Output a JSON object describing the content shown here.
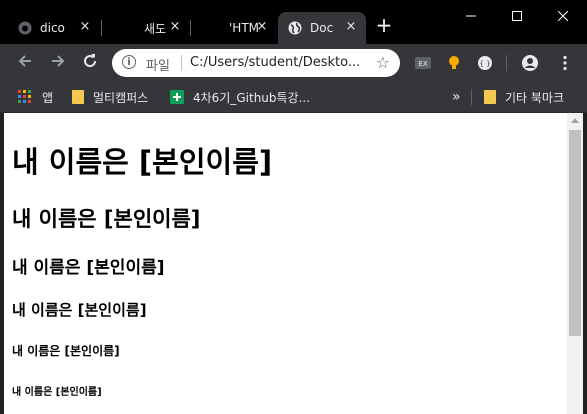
{
  "browser": {
    "tabs": [
      {
        "title": "dico",
        "icon": "github-icon"
      },
      {
        "title": "새도",
        "icon": "blank-icon"
      },
      {
        "title": "'HTM",
        "icon": "blank-icon"
      },
      {
        "title": "Doc",
        "icon": "globe-icon",
        "active": true
      }
    ],
    "close_glyph": "×",
    "new_tab_glyph": "+",
    "address": {
      "scheme_label": "파일",
      "url": "C:/Users/student/Deskto..."
    },
    "bookmarks": {
      "apps_label": "앱",
      "items": [
        {
          "label": "멀티캠퍼스",
          "icon": "folder-icon"
        },
        {
          "label": "4차6기_Github특강...",
          "icon": "sheets-icon"
        }
      ],
      "overflow": "»",
      "other_label": "기타 북마크"
    },
    "colors": {
      "tabbar": "#000000",
      "toolbar": "#35363a",
      "text": "#e8eaed",
      "folder": "#f5c94d"
    }
  },
  "page": {
    "headings": [
      "내 이름은 [본인이름]",
      "내 이름은 [본인이름]",
      "내 이름은 [본인이름]",
      "내 이름은 [본인이름]",
      "내 이름은 [본인이름]",
      "내 이름은 [본인이름]"
    ]
  }
}
